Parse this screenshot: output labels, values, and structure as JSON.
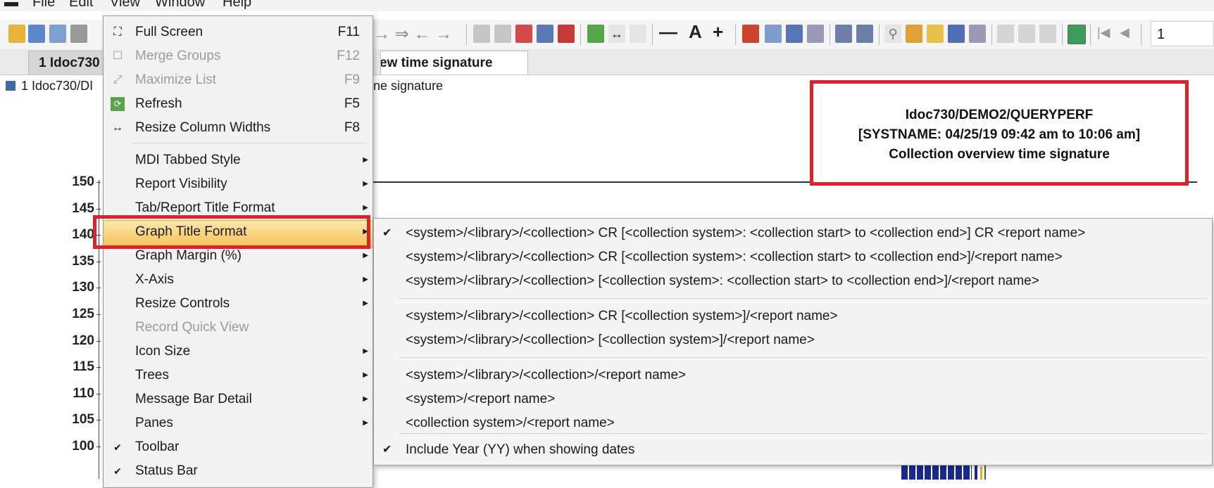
{
  "menubar": {
    "items": [
      "File",
      "Edit",
      "View",
      "Window",
      "Help"
    ]
  },
  "toolbar": {
    "minus": "—",
    "font_a": "A",
    "plus": "+",
    "page_num": "1"
  },
  "tabs": {
    "tab1": "1 Idoc730",
    "tab2": "ew time signature"
  },
  "breadcrumb": {
    "left": "1 Idoc730/DI",
    "right": "ne signature"
  },
  "y_axis": {
    "ticks": [
      "150",
      "145",
      "140",
      "135",
      "130",
      "125",
      "120",
      "115",
      "110",
      "105",
      "100"
    ]
  },
  "title_box": {
    "line1": "Idoc730/DEMO2/QUERYPERF",
    "line2": "[SYSTNAME: 04/25/19 09:42 am to 10:06 am]",
    "line3": "Collection overview time signature"
  },
  "view_menu": {
    "items": [
      {
        "label": "Full Screen",
        "shortcut": "F11",
        "icon": "fullscreen-icon",
        "glyph": "⛶",
        "disabled": false
      },
      {
        "label": "Merge Groups",
        "shortcut": "F12",
        "icon": "merge-groups-icon",
        "glyph": "☐",
        "disabled": true
      },
      {
        "label": "Maximize List",
        "shortcut": "F9",
        "icon": "maximize-icon",
        "glyph": "⤢",
        "disabled": true
      },
      {
        "label": "Refresh",
        "shortcut": "F5",
        "icon": "refresh-icon",
        "glyph": "⟳",
        "disabled": false
      },
      {
        "label": "Resize Column Widths",
        "shortcut": "F8",
        "icon": "resize-columns-icon",
        "glyph": "↔",
        "disabled": false
      },
      {
        "label": "MDI Tabbed Style",
        "submenu": true
      },
      {
        "label": "Report Visibility",
        "submenu": true
      },
      {
        "label": "Tab/Report Title Format",
        "submenu": true
      },
      {
        "label": "Graph Title Format",
        "submenu": true,
        "highlighted": true
      },
      {
        "label": "Graph Margin (%)",
        "submenu": true
      },
      {
        "label": "X-Axis",
        "submenu": true
      },
      {
        "label": "Resize Controls",
        "submenu": true
      },
      {
        "label": "Record Quick View",
        "disabled": true
      },
      {
        "label": "Icon Size",
        "submenu": true
      },
      {
        "label": "Trees",
        "submenu": true
      },
      {
        "label": "Message Bar Detail",
        "submenu": true
      },
      {
        "label": "Panes",
        "submenu": true
      },
      {
        "label": "Toolbar",
        "checked": true
      },
      {
        "label": "Status Bar",
        "checked": true
      }
    ]
  },
  "submenu": {
    "items": [
      {
        "label": "<system>/<library>/<collection> CR [<collection system>: <collection start> to <collection end>] CR <report name>",
        "checked": true
      },
      {
        "label": "<system>/<library>/<collection> CR [<collection system>: <collection start> to <collection end>]/<report name>"
      },
      {
        "label": "<system>/<library>/<collection> [<collection system>: <collection start> to <collection end>]/<report name>"
      },
      {
        "label": "<system>/<library>/<collection> CR [<collection system>]/<report name>"
      },
      {
        "label": "<system>/<library>/<collection> [<collection system>]/<report name>"
      },
      {
        "label": "<system>/<library>/<collection>/<report name>"
      },
      {
        "label": "<system>/<report name>"
      },
      {
        "label": "<collection system>/<report name>"
      },
      {
        "label": "Include Year (YY) when showing dates",
        "checked": true
      }
    ]
  },
  "colors": {
    "highlight_red": "#d9232d",
    "menu_hover": "#f7c35a"
  }
}
